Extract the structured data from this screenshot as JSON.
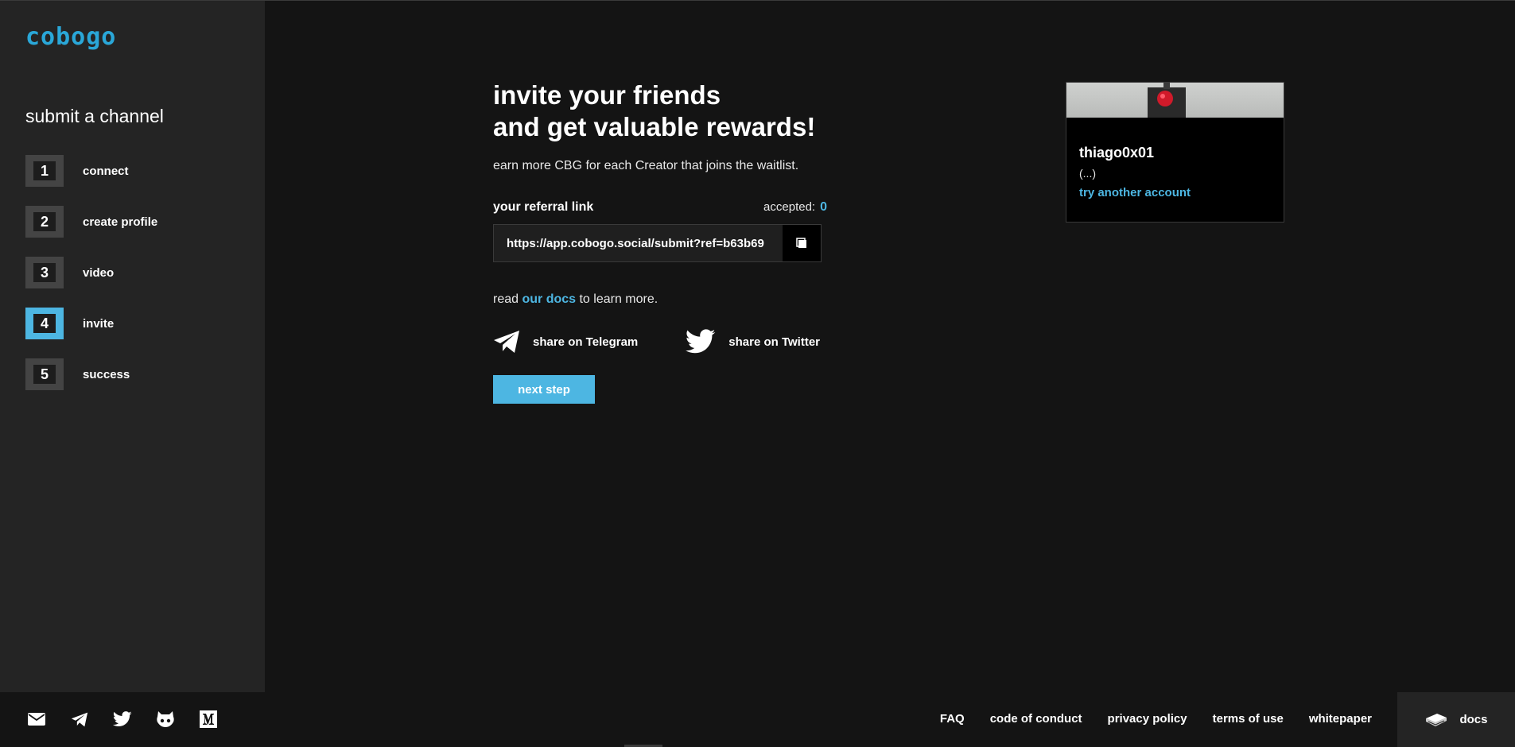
{
  "brand": {
    "name": "cobogo"
  },
  "sidebar": {
    "title": "submit a channel",
    "steps": [
      {
        "num": "1",
        "label": "connect"
      },
      {
        "num": "2",
        "label": "create profile"
      },
      {
        "num": "3",
        "label": "video"
      },
      {
        "num": "4",
        "label": "invite",
        "active": true
      },
      {
        "num": "5",
        "label": "success"
      }
    ]
  },
  "main": {
    "headline_line1": "invite your friends",
    "headline_line2_prefix": "and ",
    "headline_line2_bold": "get valuable rewards!",
    "subtitle": "earn more CBG for each Creator that joins the waitlist.",
    "referral_label": "your referral link",
    "accepted_label": "accepted:",
    "accepted_count": "0",
    "referral_url": "https://app.cobogo.social/submit?ref=b63b69",
    "docs_prefix": "read ",
    "docs_link": "our docs",
    "docs_suffix": " to learn more.",
    "share_telegram": "share on Telegram",
    "share_twitter": "share on Twitter",
    "next_step": "next step"
  },
  "account": {
    "name": "thiago0x01",
    "description": "(...)",
    "switch_link": "try another account"
  },
  "footer": {
    "icons": [
      "mail-icon",
      "telegram-icon",
      "twitter-icon",
      "github-icon",
      "medium-icon"
    ],
    "links": [
      "FAQ",
      "code of conduct",
      "privacy policy",
      "terms of use",
      "whitepaper"
    ],
    "docs": "docs"
  },
  "colors": {
    "accent": "#4db6e2",
    "logo": "#2aa7d8",
    "background": "#141414",
    "sidebar": "#242424"
  }
}
